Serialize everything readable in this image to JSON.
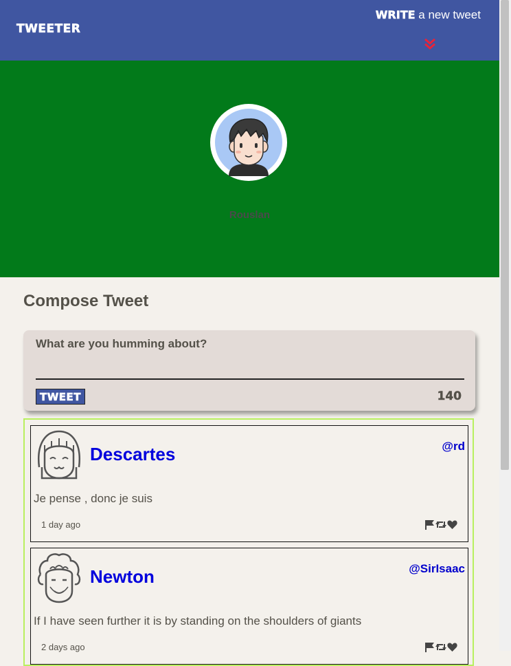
{
  "nav": {
    "brand": "TWEETER",
    "write_strong": "WRITE",
    "write_rest": "a new tweet"
  },
  "profile": {
    "name": "Rouslan"
  },
  "compose": {
    "title": "Compose Tweet",
    "label": "What are you humming about?",
    "textarea_value": "",
    "button_label": "TWEET",
    "counter": "140"
  },
  "tweets": [
    {
      "name": "Descartes",
      "handle": "@rd",
      "text": "Je pense , donc je suis",
      "time": "1 day ago"
    },
    {
      "name": "Newton",
      "handle": "@SirIsaac",
      "text": "If I have seen further it is by standing on the shoulders of giants",
      "time": "2 days ago"
    }
  ],
  "icons": {
    "chevron": "double-chevron-down",
    "flag": "flag-icon",
    "retweet": "retweet-icon",
    "like": "heart-icon"
  },
  "colors": {
    "nav": "#4056a1",
    "hero": "#027a1a",
    "accent_chevron": "#e8233a",
    "tweet_name": "#0000dd",
    "feed_border": "#b8f05e"
  }
}
